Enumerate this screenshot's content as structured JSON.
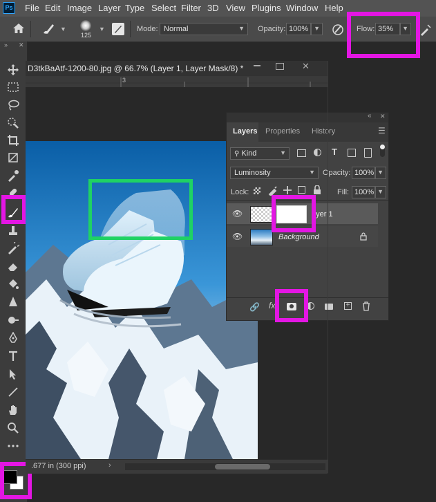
{
  "menu": {
    "logo": "Ps",
    "items": [
      "File",
      "Edit",
      "Image",
      "Layer",
      "Type",
      "Select",
      "Filter",
      "3D",
      "View",
      "Plugins",
      "Window",
      "Help"
    ]
  },
  "options": {
    "brush_size": "125",
    "mode_label": "Mode:",
    "mode_value": "Normal",
    "opacity_label": "Opacity:",
    "opacity_value": "100%",
    "flow_label": "Flow:",
    "flow_value": "35%"
  },
  "document": {
    "title": "D3tkBaAtf-1200-80.jpg @ 66.7% (Layer 1, Layer Mask/8) *",
    "ruler_mark": "3",
    "status": ".677 in (300 ppi)"
  },
  "layers_panel": {
    "tabs": [
      "Layers",
      "Properties",
      "History"
    ],
    "filter_kind": "Kind",
    "blend_mode": "Luminosity",
    "opacity_label": "Opacity:",
    "opacity_value": "100%",
    "lock_label": "Lock:",
    "fill_label": "Fill:",
    "fill_value": "100%",
    "layers": [
      {
        "name": "ayer 1"
      },
      {
        "name": "Background"
      }
    ]
  },
  "colors": {
    "highlight": "#e316e3",
    "green_box": "#1fd264",
    "panel_bg": "#424242",
    "menubar_bg": "#535353"
  }
}
